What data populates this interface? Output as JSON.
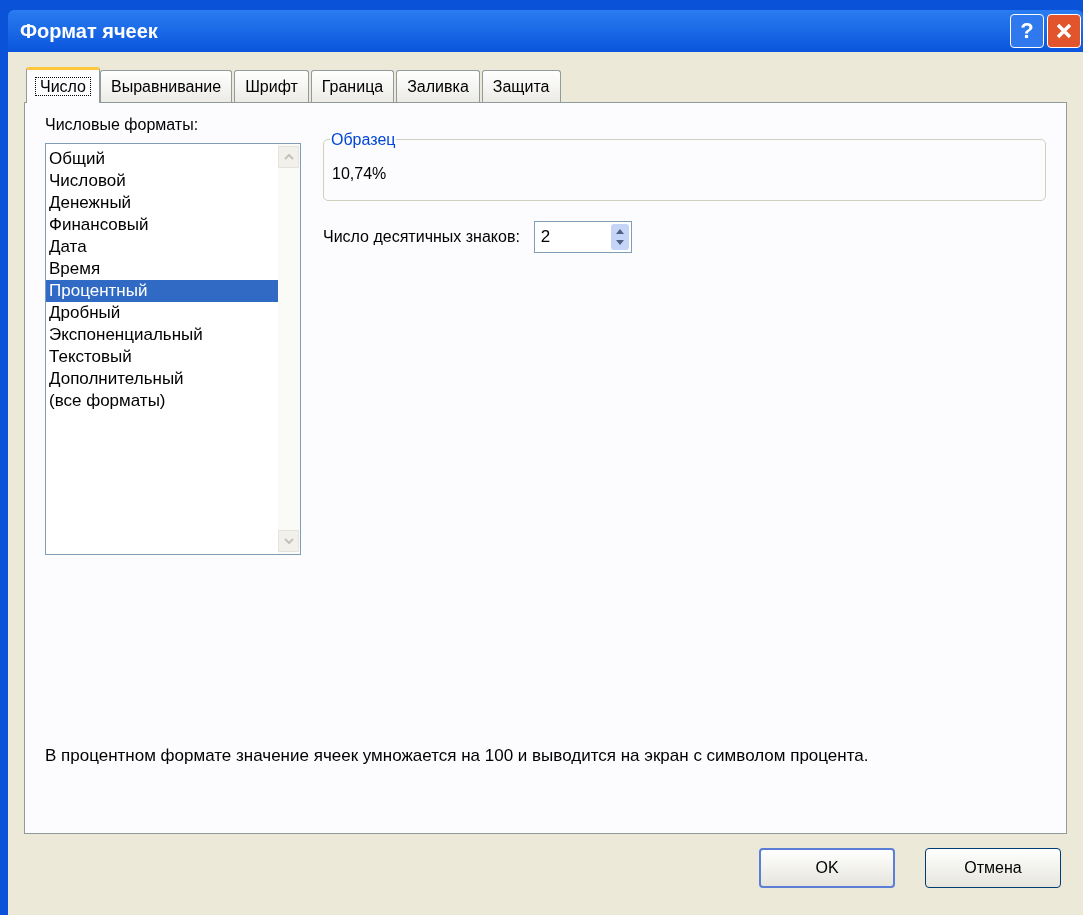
{
  "window": {
    "title": "Формат ячеек",
    "help_button": "?"
  },
  "tabs": [
    {
      "label": "Число",
      "selected": true
    },
    {
      "label": "Выравнивание",
      "selected": false
    },
    {
      "label": "Шрифт",
      "selected": false
    },
    {
      "label": "Граница",
      "selected": false
    },
    {
      "label": "Заливка",
      "selected": false
    },
    {
      "label": "Защита",
      "selected": false
    }
  ],
  "formats": {
    "label": "Числовые форматы:",
    "items": [
      {
        "label": "Общий",
        "selected": false
      },
      {
        "label": "Числовой",
        "selected": false
      },
      {
        "label": "Денежный",
        "selected": false
      },
      {
        "label": "Финансовый",
        "selected": false
      },
      {
        "label": "Дата",
        "selected": false
      },
      {
        "label": "Время",
        "selected": false
      },
      {
        "label": "Процентный",
        "selected": true
      },
      {
        "label": "Дробный",
        "selected": false
      },
      {
        "label": "Экспоненциальный",
        "selected": false
      },
      {
        "label": "Текстовый",
        "selected": false
      },
      {
        "label": "Дополнительный",
        "selected": false
      },
      {
        "label": "(все форматы)",
        "selected": false
      }
    ]
  },
  "sample": {
    "label": "Образец",
    "value": "10,74%"
  },
  "decimals": {
    "label": "Число десятичных знаков:",
    "value": "2"
  },
  "description": "В процентном формате значение ячеек умножается на 100 и выводится на экран с символом процента.",
  "buttons": [
    {
      "label": "OK",
      "default": true
    },
    {
      "label": "Отмена",
      "default": false
    }
  ]
}
